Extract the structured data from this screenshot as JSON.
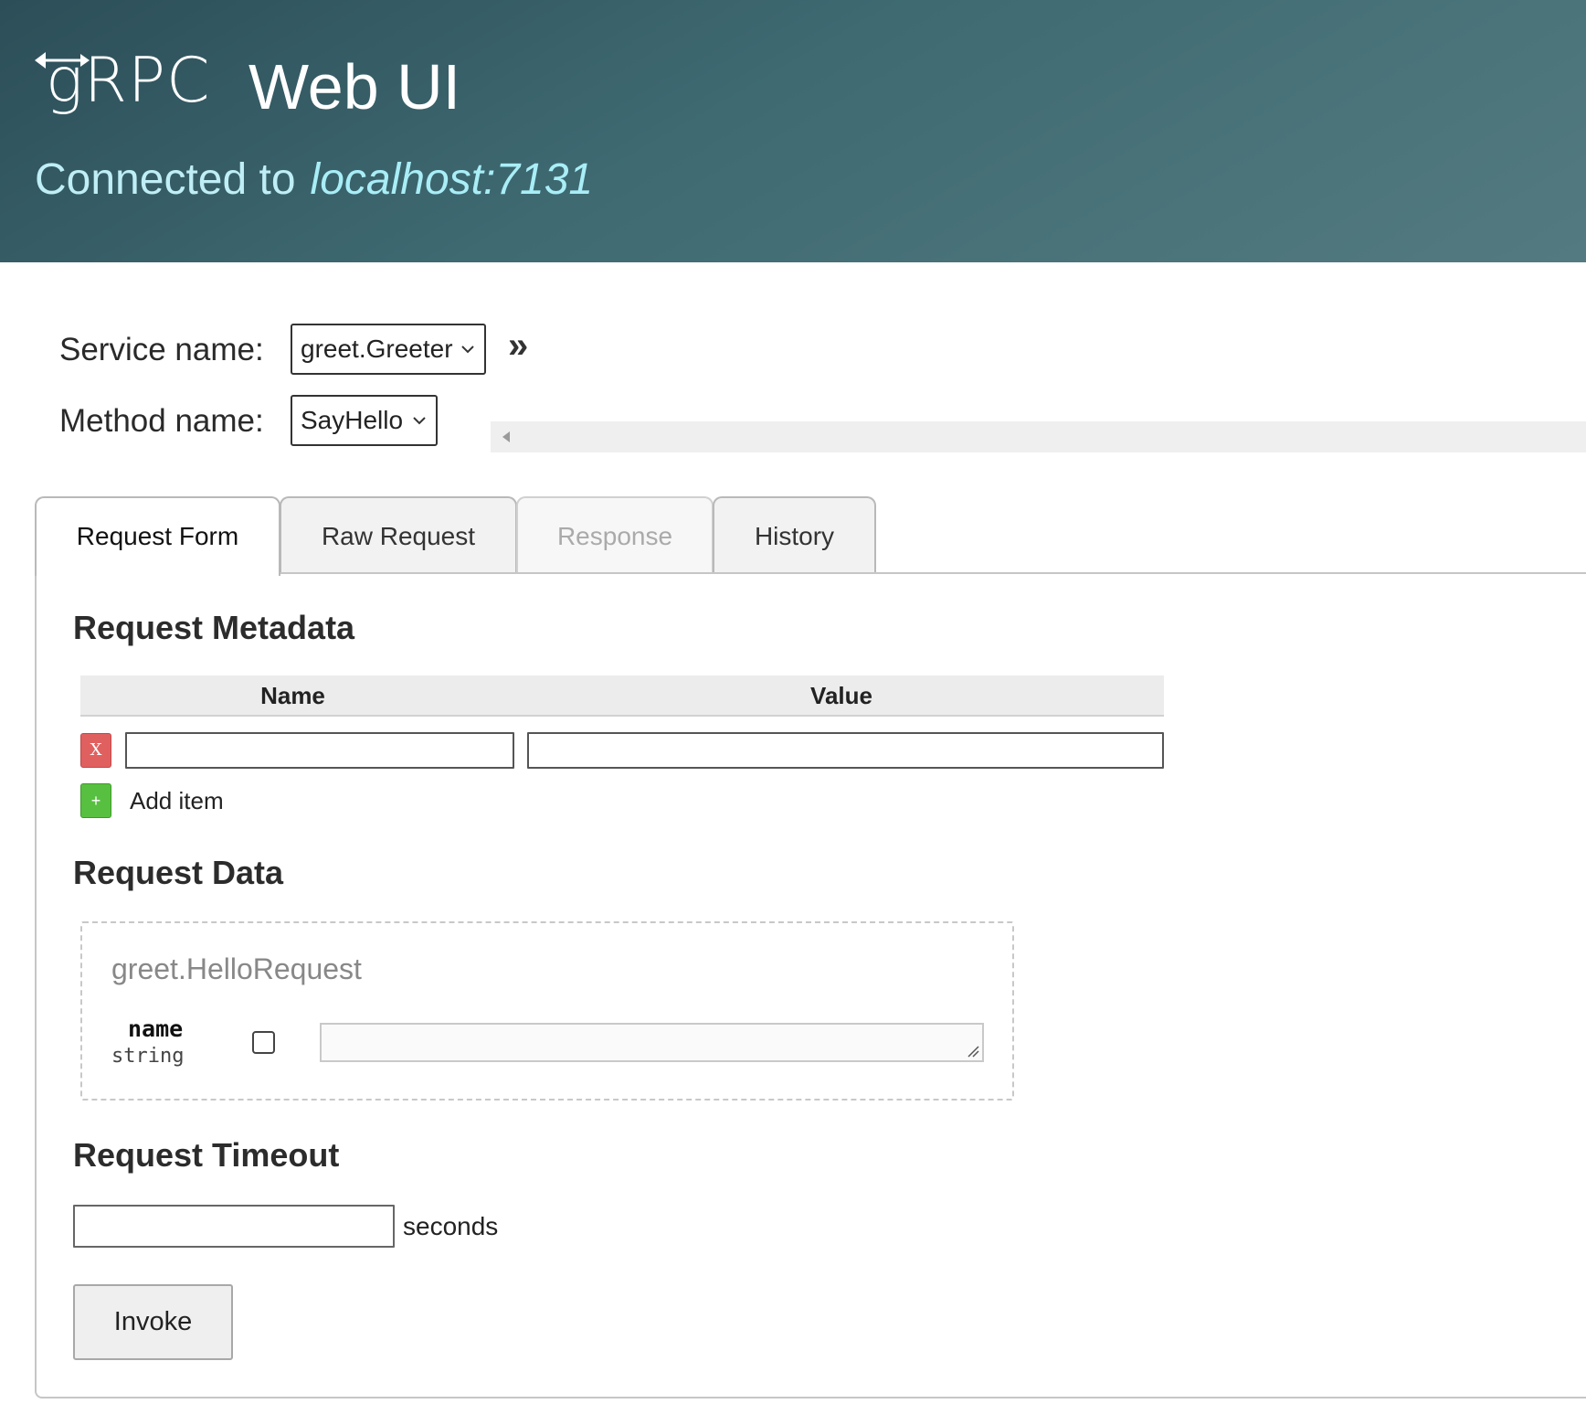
{
  "header": {
    "logo_text": "gRPC",
    "title": "Web UI",
    "connected_label": "Connected to",
    "host": "localhost:7131"
  },
  "service": {
    "label": "Service name:",
    "selected": "greet.Greeter",
    "expand_icon": "double-chevron-right-icon",
    "expand_glyph": "»"
  },
  "method": {
    "label": "Method name:",
    "selected": "SayHello"
  },
  "tabs": [
    {
      "label": "Request Form",
      "state": "active"
    },
    {
      "label": "Raw Request",
      "state": "normal"
    },
    {
      "label": "Response",
      "state": "disabled"
    },
    {
      "label": "History",
      "state": "normal"
    }
  ],
  "request_metadata": {
    "title": "Request Metadata",
    "columns": [
      "Name",
      "Value"
    ],
    "rows": [
      {
        "remove_label": "X",
        "name": "",
        "value": ""
      }
    ],
    "add_button_label": "+",
    "add_label": "Add item"
  },
  "request_data": {
    "title": "Request Data",
    "message_type": "greet.HelloRequest",
    "fields": [
      {
        "name": "name",
        "type": "string",
        "checked": false,
        "value": ""
      }
    ]
  },
  "request_timeout": {
    "title": "Request Timeout",
    "value": "",
    "unit": "seconds"
  },
  "invoke_label": "Invoke",
  "colors": {
    "header_gradient_start": "#2c4e58",
    "header_gradient_end": "#537a80",
    "host_text": "#a9eef7",
    "remove_button": "#e06060",
    "add_button": "#58c040"
  }
}
